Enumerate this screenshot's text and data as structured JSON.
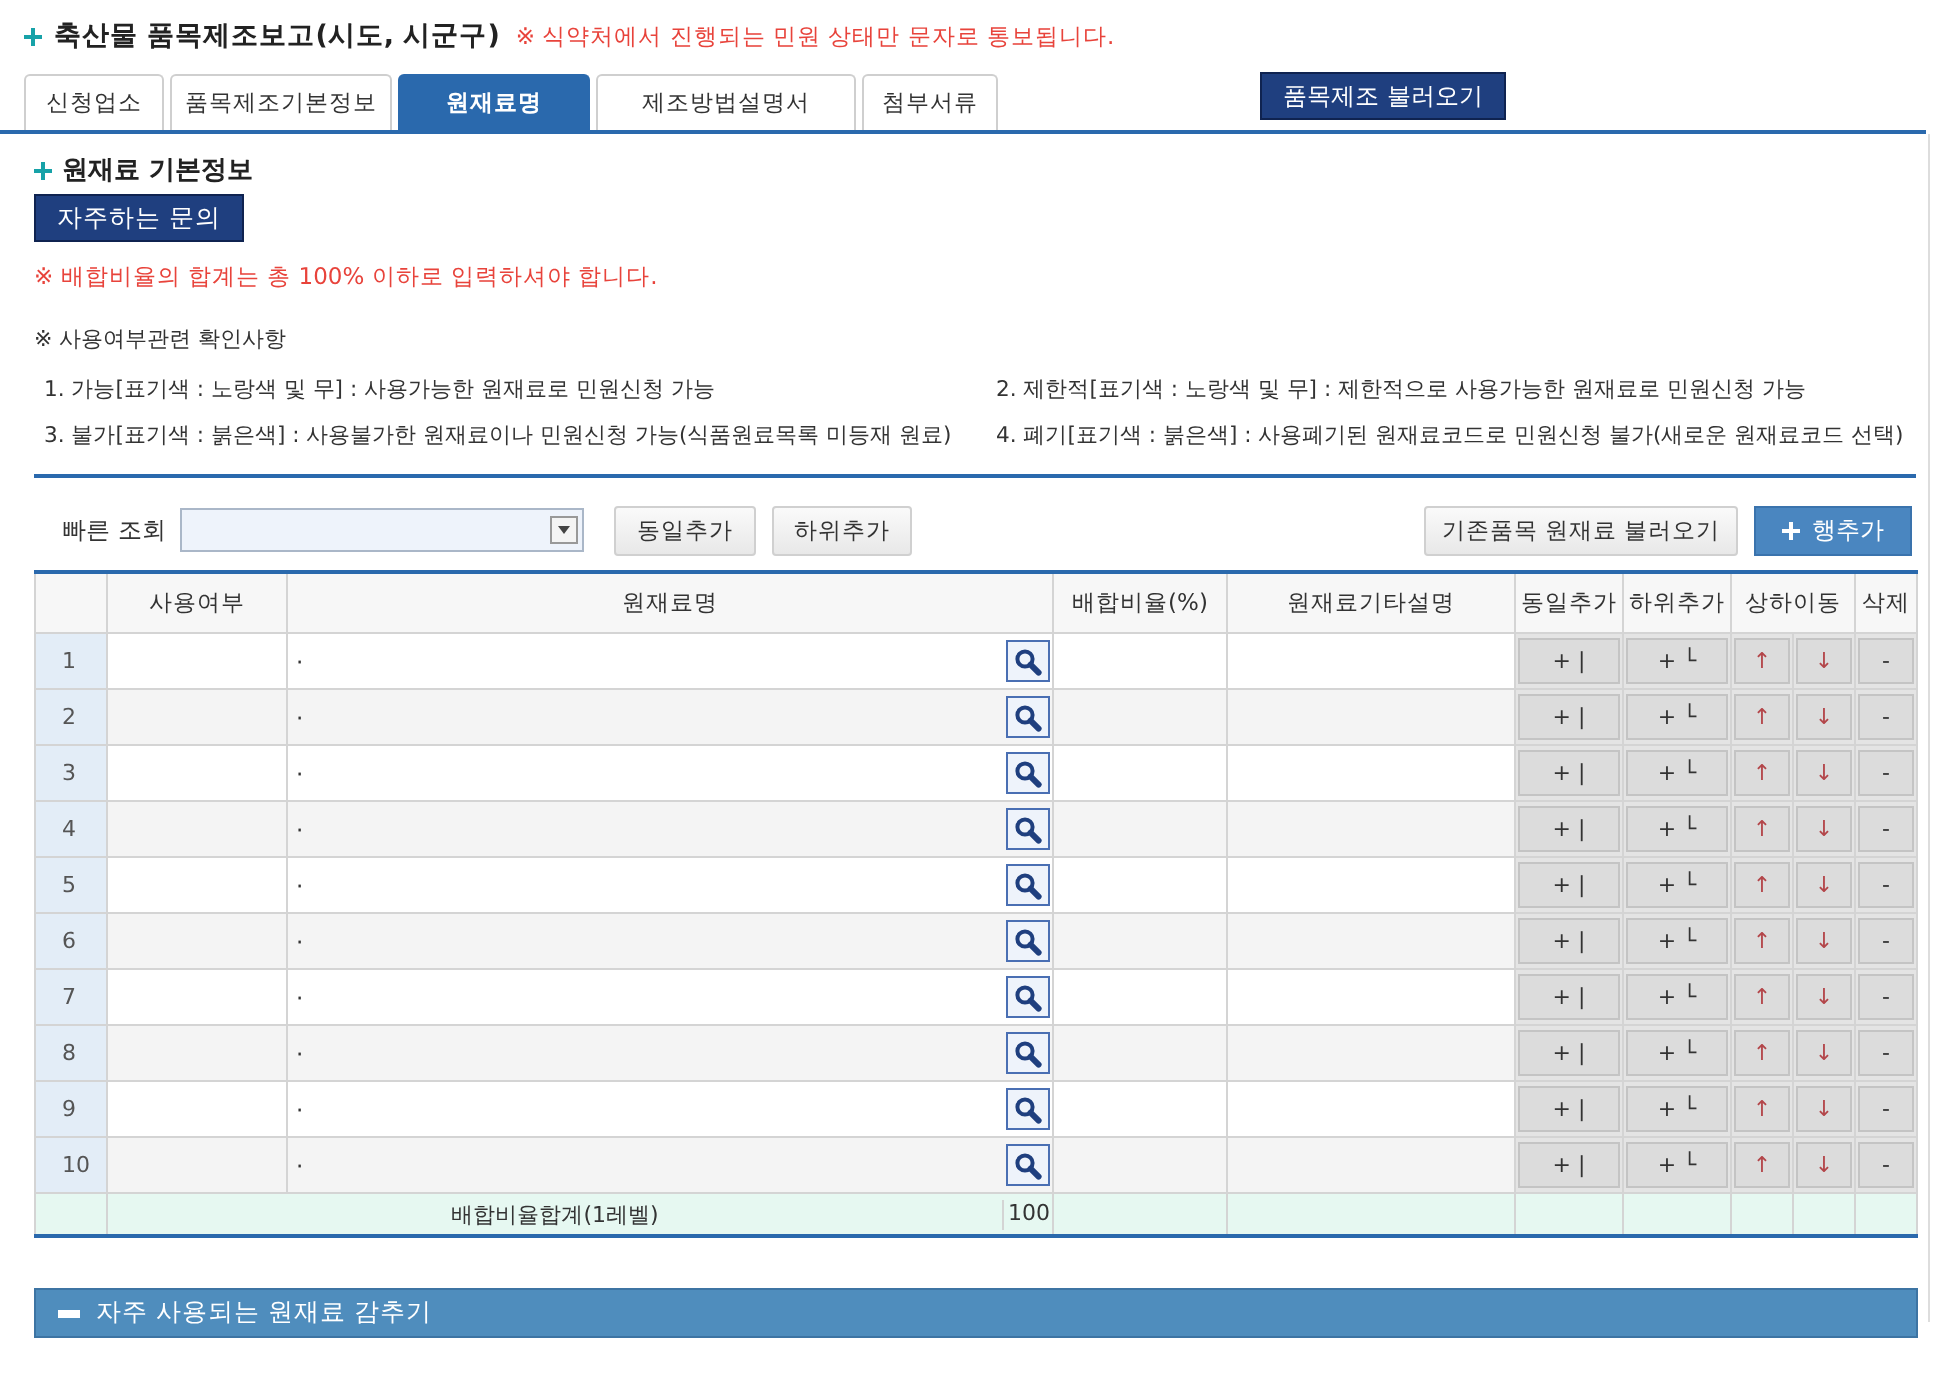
{
  "title": "축산물 품목제조보고(시도, 시군구)",
  "notice": "※ 식약처에서 진행되는 민원 상태만 문자로 통보됩니다.",
  "tabs": [
    {
      "label": "신청업소",
      "selected": false
    },
    {
      "label": "품목제조기본정보",
      "selected": false
    },
    {
      "label": "원재료명",
      "selected": true
    },
    {
      "label": "제조방법설명서",
      "selected": false
    },
    {
      "label": "첨부서류",
      "selected": false
    }
  ],
  "load_button": "품목제조 불러오기",
  "section_title": "원재료 기본정보",
  "faq_button": "자주하는 문의",
  "ratio_warning": "※ 배합비율의 합계는 총 100% 이하로 입력하셔야 합니다.",
  "usage_heading": "※ 사용여부관련 확인사항",
  "usage_notes": [
    "1. 가능[표기색 : 노랑색 및 무] : 사용가능한 원재료로 민원신청 가능",
    "2. 제한적[표기색 : 노랑색 및 무] : 제한적으로 사용가능한 원재료로 민원신청 가능",
    "3. 불가[표기색 : 붉은색] : 사용불가한 원재료이나 민원신청 가능(식품원료목록 미등재 원료)",
    "4. 폐기[표기색 : 붉은색] : 사용폐기된 원재료코드로 민원신청 불가(새로운 원재료코드 선택)"
  ],
  "toolbar": {
    "quick_search_label": "빠른 조회",
    "same_add": "동일추가",
    "sub_add": "하위추가",
    "load_existing": "기존품목 원재료 불러오기",
    "add_row": "행추가"
  },
  "table": {
    "columns": [
      "사용여부",
      "원재료명",
      "배합비율(%)",
      "원재료기타설명",
      "동일추가",
      "하위추가",
      "상하이동",
      "삭제"
    ],
    "rows": [
      {
        "no": "1",
        "bullet": "·",
        "same": "+ |",
        "sub": "+ └",
        "up": "↑",
        "down": "↓",
        "del": "-"
      },
      {
        "no": "2",
        "bullet": "·",
        "same": "+ |",
        "sub": "+ └",
        "up": "↑",
        "down": "↓",
        "del": "-"
      },
      {
        "no": "3",
        "bullet": "·",
        "same": "+ |",
        "sub": "+ └",
        "up": "↑",
        "down": "↓",
        "del": "-"
      },
      {
        "no": "4",
        "bullet": "·",
        "same": "+ |",
        "sub": "+ └",
        "up": "↑",
        "down": "↓",
        "del": "-"
      },
      {
        "no": "5",
        "bullet": "·",
        "same": "+ |",
        "sub": "+ └",
        "up": "↑",
        "down": "↓",
        "del": "-"
      },
      {
        "no": "6",
        "bullet": "·",
        "same": "+ |",
        "sub": "+ └",
        "up": "↑",
        "down": "↓",
        "del": "-"
      },
      {
        "no": "7",
        "bullet": "·",
        "same": "+ |",
        "sub": "+ └",
        "up": "↑",
        "down": "↓",
        "del": "-"
      },
      {
        "no": "8",
        "bullet": "·",
        "same": "+ |",
        "sub": "+ └",
        "up": "↑",
        "down": "↓",
        "del": "-"
      },
      {
        "no": "9",
        "bullet": "·",
        "same": "+ |",
        "sub": "+ └",
        "up": "↑",
        "down": "↓",
        "del": "-"
      },
      {
        "no": "10",
        "bullet": "·",
        "same": "+ |",
        "sub": "+ └",
        "up": "↑",
        "down": "↓",
        "del": "-"
      }
    ],
    "total": {
      "label": "배합비율합계(1레벨)",
      "value": "100"
    }
  },
  "collapse_bar": {
    "label": "자주 사용되는 원재료 감추기",
    "expanded": true
  }
}
